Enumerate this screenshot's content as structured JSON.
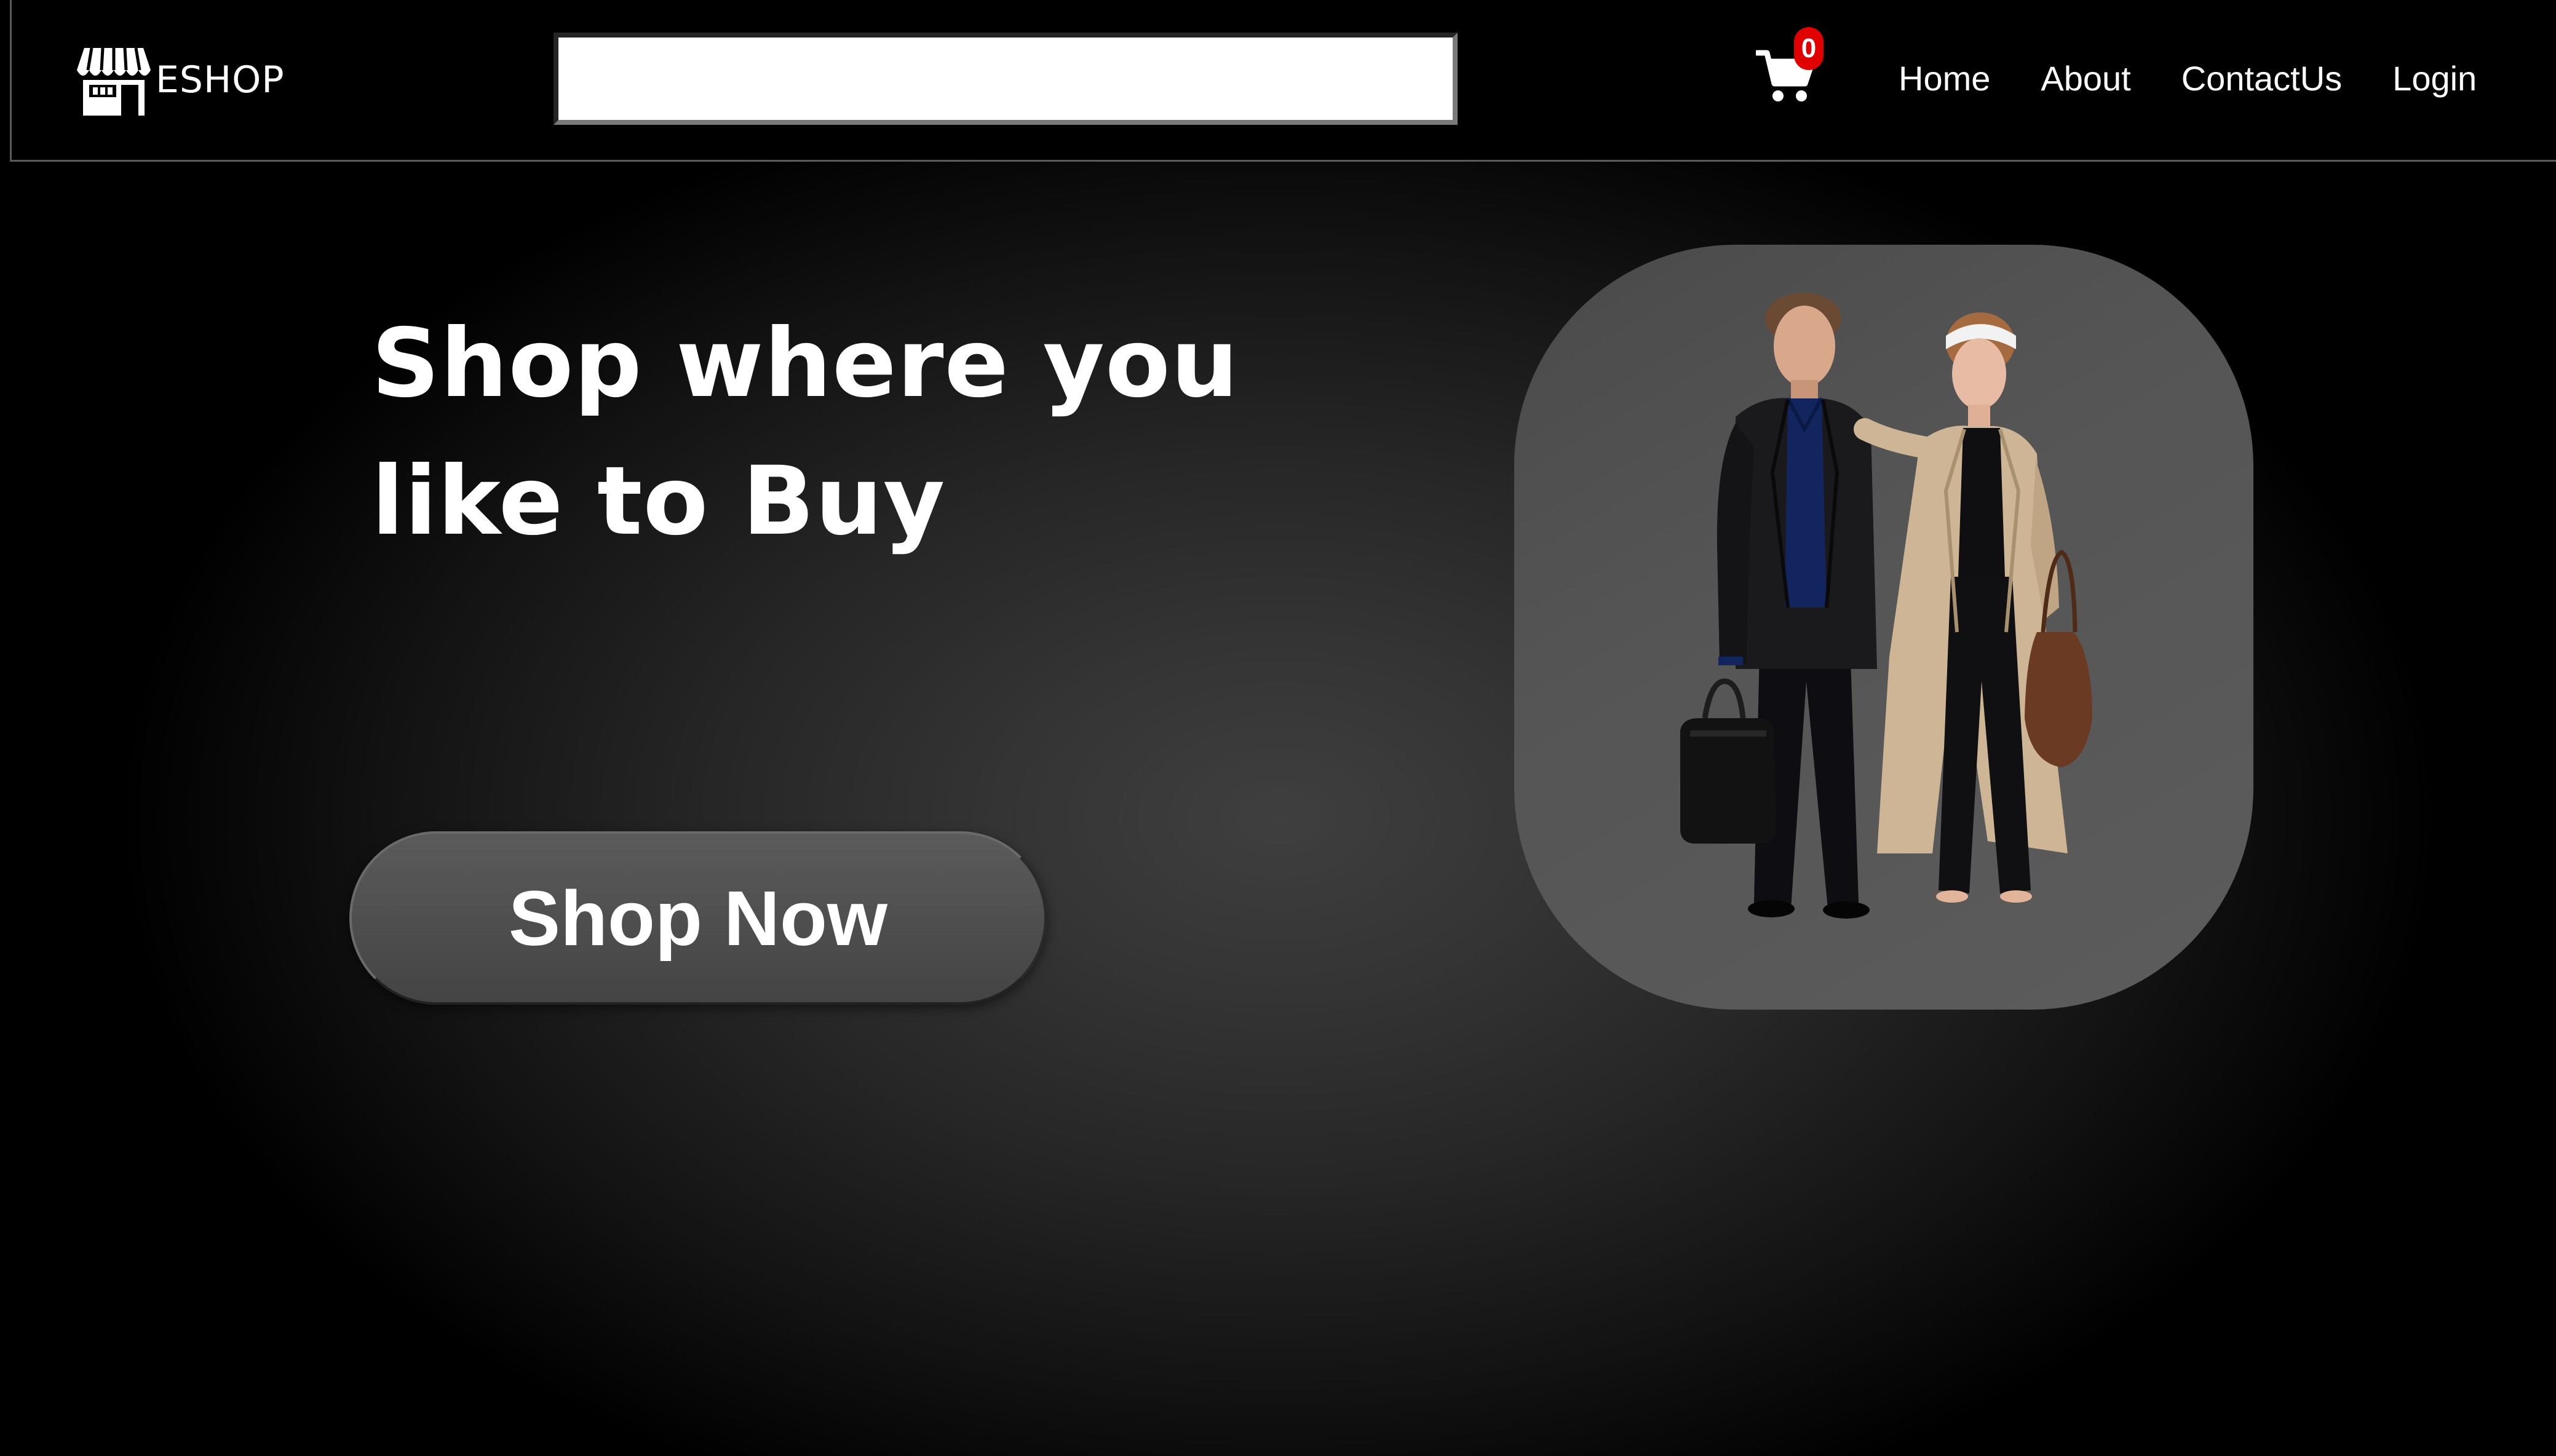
{
  "navbar": {
    "brand": "ESHOP",
    "brand_icon": "storefront-icon",
    "search": {
      "value": "",
      "placeholder": ""
    },
    "cart": {
      "icon": "shopping-cart-icon",
      "count": "0",
      "badge_color": "#e00000"
    },
    "links": [
      {
        "label": "Home"
      },
      {
        "label": "About"
      },
      {
        "label": "ContactUs"
      },
      {
        "label": "Login"
      }
    ]
  },
  "hero": {
    "title_line1": "Shop where you",
    "title_line2": "like to Buy",
    "cta_label": "Shop Now",
    "image_icon": "fashion-couple-image"
  },
  "colors": {
    "background": "#000000",
    "button": "#555555",
    "image_panel": "#555555"
  }
}
